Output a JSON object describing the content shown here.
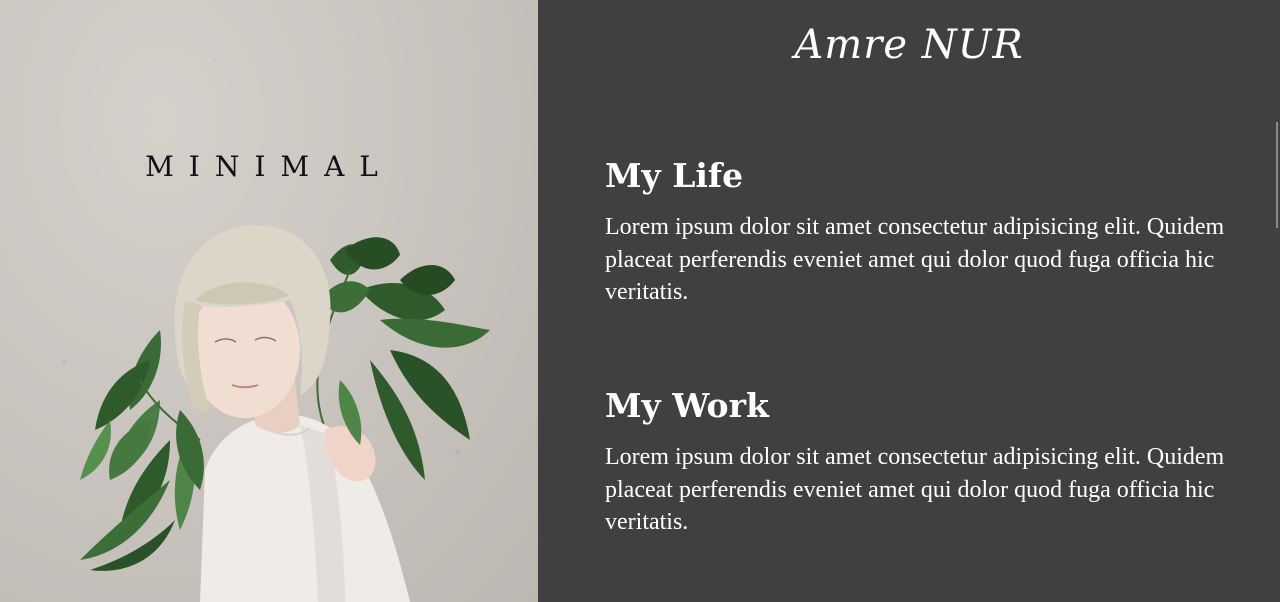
{
  "hero": {
    "brand": "MINIMAL",
    "photo_icon": "woman-with-leaves-photo"
  },
  "header": {
    "signature": "Amre NUR"
  },
  "sections": [
    {
      "title": "My Life",
      "text": "Lorem ipsum dolor sit amet consectetur adipisicing elit. Quidem placeat perferendis eveniet amet qui dolor quod fuga officia hic veritatis."
    },
    {
      "title": "My Work",
      "text": "Lorem ipsum dolor sit amet consectetur adipisicing elit. Quidem placeat perferendis eveniet amet qui dolor quod fuga officia hic veritatis."
    }
  ],
  "colors": {
    "panel_background": "#404040",
    "text": "#ffffff",
    "photo_background": "#cbc5c0"
  }
}
